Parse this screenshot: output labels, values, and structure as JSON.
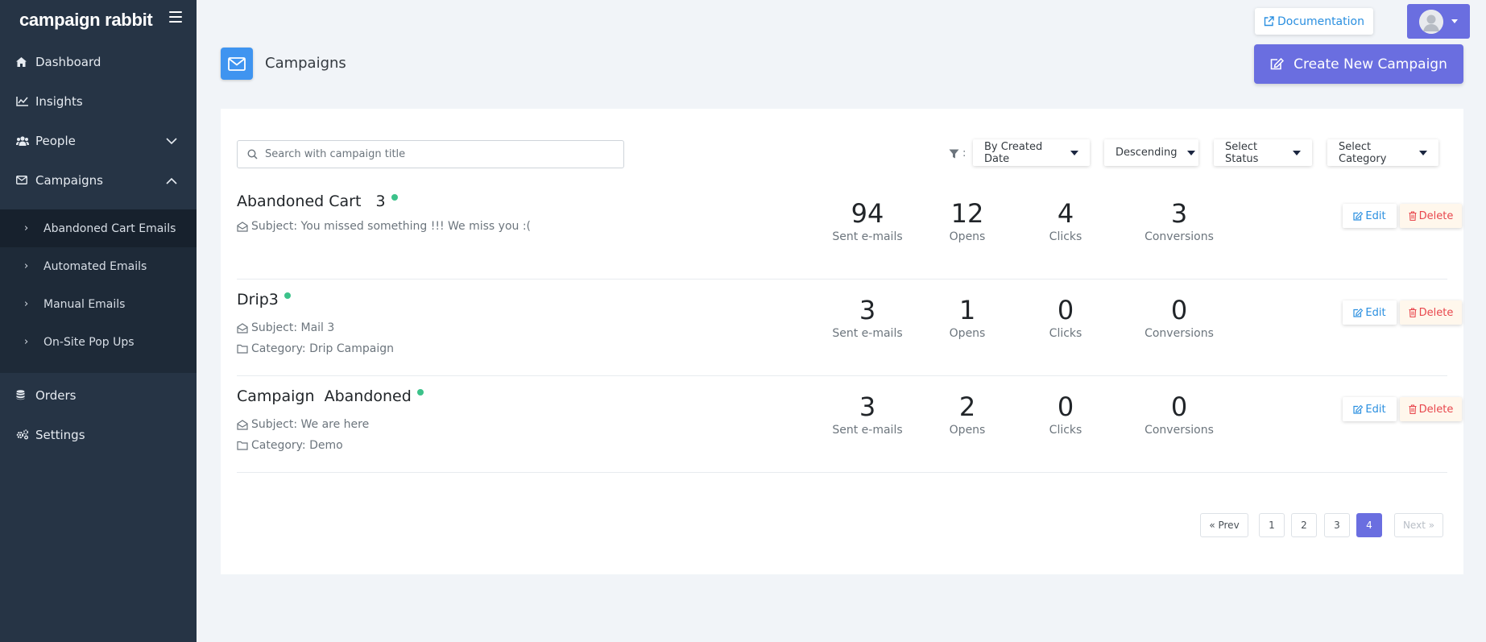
{
  "brand": {
    "name": "campaign rabbit"
  },
  "sidebar": {
    "items": [
      {
        "label": "Dashboard",
        "icon": "home-icon"
      },
      {
        "label": "Insights",
        "icon": "line-chart-icon"
      },
      {
        "label": "People",
        "icon": "users-icon"
      },
      {
        "label": "Campaigns",
        "icon": "envelope-icon"
      },
      {
        "label": "Orders",
        "icon": "database-icon"
      },
      {
        "label": "Settings",
        "icon": "gears-icon"
      }
    ],
    "campaign_sub": [
      {
        "label": "Abandoned Cart Emails",
        "active": true
      },
      {
        "label": "Automated Emails"
      },
      {
        "label": "Manual Emails"
      },
      {
        "label": "On-Site Pop Ups"
      }
    ]
  },
  "topbar": {
    "documentation": "Documentation"
  },
  "header": {
    "title": "Campaigns",
    "create_button": "Create New Campaign"
  },
  "filters": {
    "search_placeholder": "Search with campaign title",
    "filter_label": ":",
    "sort_by": "By Created Date",
    "order": "Descending",
    "status": "Select Status",
    "category": "Select Category"
  },
  "campaigns": [
    {
      "title": "Abandoned Cart   3",
      "subject": "Subject: You missed something !!! We miss you :(",
      "category": "",
      "sent": "94",
      "opens": "12",
      "clicks": "4",
      "conversions": "3"
    },
    {
      "title": "Drip3",
      "subject": "Subject: Mail 3",
      "category": "Category: Drip Campaign",
      "sent": "3",
      "opens": "1",
      "clicks": "0",
      "conversions": "0"
    },
    {
      "title": "Campaign  Abandoned",
      "subject": "Subject: We are here",
      "category": "Category: Demo",
      "sent": "3",
      "opens": "2",
      "clicks": "0",
      "conversions": "0"
    }
  ],
  "stat_labels": {
    "sent": "Sent e-mails",
    "opens": "Opens",
    "clicks": "Clicks",
    "conversions": "Conversions"
  },
  "row_actions": {
    "edit": "Edit",
    "delete": "Delete"
  },
  "pagination": {
    "prev": "« Prev",
    "pages": [
      "1",
      "2",
      "3",
      "4"
    ],
    "current": "4",
    "next": "Next »"
  },
  "colors": {
    "sidebar": "#263445",
    "accent": "#6a6ee0",
    "link": "#2a8fe0",
    "danger": "#e8474d",
    "active_dot": "#3cc28a"
  }
}
